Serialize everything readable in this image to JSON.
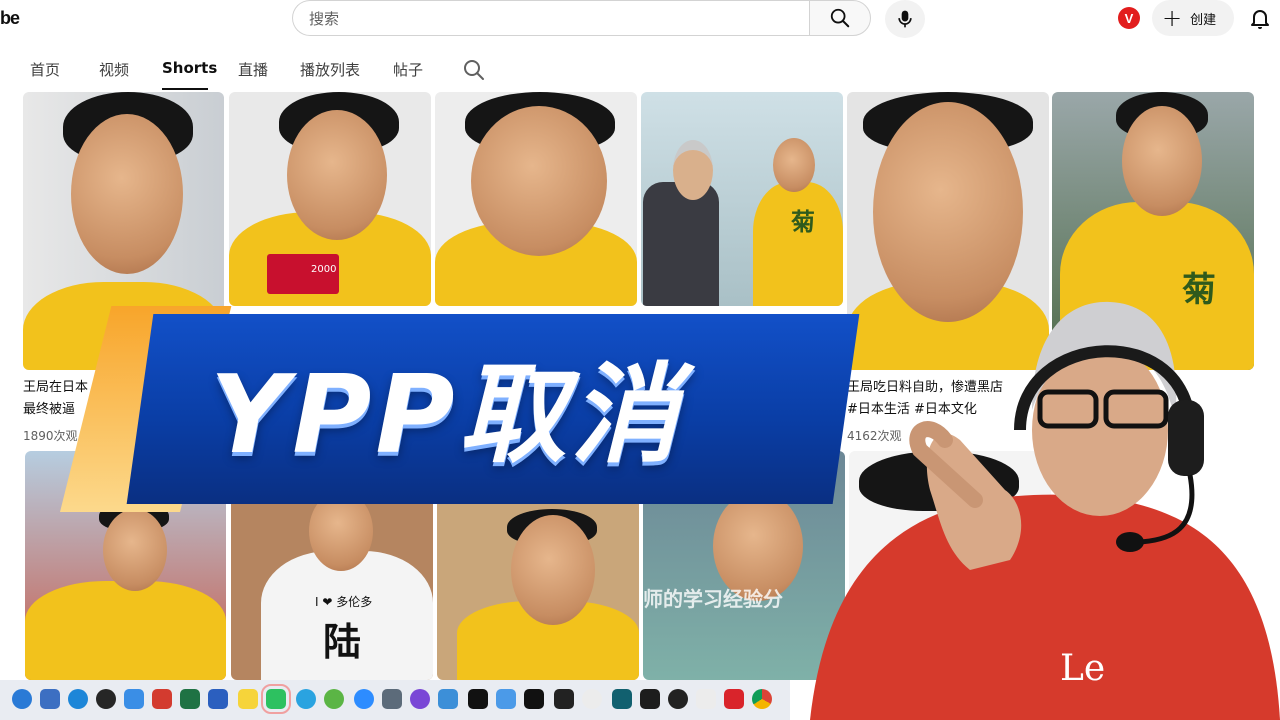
{
  "header": {
    "logo_fragment": "be",
    "search_placeholder": "搜索",
    "create_label": "创建",
    "browser_badge": "V"
  },
  "tabs": [
    {
      "label": "首页",
      "active": false
    },
    {
      "label": "视频",
      "active": false
    },
    {
      "label": "Shorts",
      "active": true
    },
    {
      "label": "直播",
      "active": false
    },
    {
      "label": "播放列表",
      "active": false
    },
    {
      "label": "帖子",
      "active": false
    }
  ],
  "row1": [
    {
      "title_line1": "王局在日本",
      "title_line2": "最终被逼",
      "views": "1890次观"
    },
    {
      "title_line1": "",
      "title_line2": "",
      "views": ""
    },
    {
      "title_line1": "",
      "title_line2": "",
      "views": ""
    },
    {
      "title_line1": "",
      "title_line2": "",
      "views": ""
    },
    {
      "title_line1": "王局吃日料自助，惨遭黑店",
      "title_line2": "#日本生活 #日本文化",
      "views": "4162次观"
    },
    {
      "title_line1": "",
      "title_line2": "",
      "views": ""
    }
  ],
  "thumb_texts": {
    "kfc_card": "2000",
    "shirt_text": "I ❤ 多伦多",
    "shirt_char": "陆",
    "chest_char": "菊",
    "subtitle": "师的学习经验分"
  },
  "banner": {
    "text": "YPP取消"
  },
  "colors": {
    "banner_blue": "#0a3ea6",
    "banner_orange": "#f8a52a",
    "shirt_yellow": "#f2c21c",
    "presenter_red": "#d63a2c"
  }
}
